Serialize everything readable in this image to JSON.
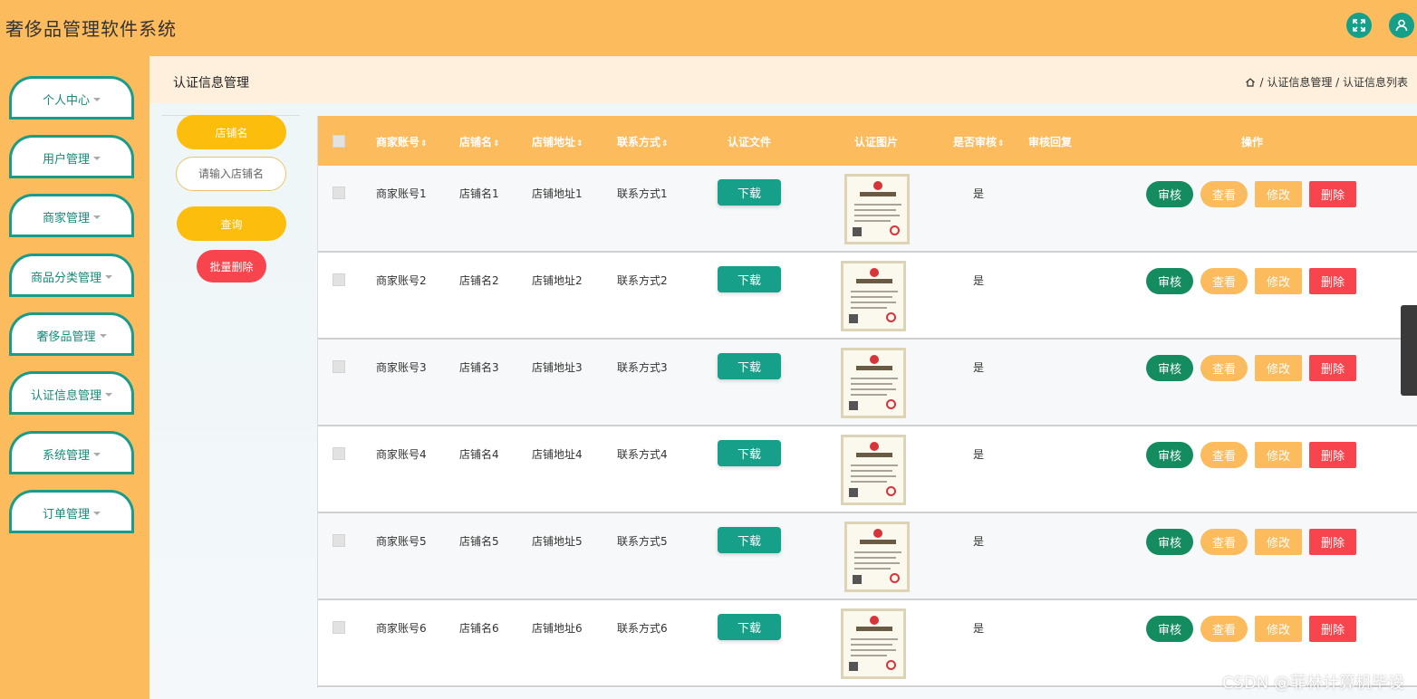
{
  "app": {
    "title": "奢侈品管理软件系统"
  },
  "topbar": {
    "fullscreen_icon": "expand-icon",
    "user_icon": "user-icon"
  },
  "sidebar": {
    "items": [
      {
        "label": "个人中心"
      },
      {
        "label": "用户管理"
      },
      {
        "label": "商家管理"
      },
      {
        "label": "商品分类管理"
      },
      {
        "label": "奢侈品管理"
      },
      {
        "label": "认证信息管理"
      },
      {
        "label": "系统管理"
      },
      {
        "label": "订单管理"
      }
    ]
  },
  "breadcrumb": {
    "title": "认证信息管理",
    "home_icon": "home-icon",
    "path": "/ 认证信息管理 / 认证信息列表"
  },
  "search": {
    "field_label": "店铺名",
    "input_placeholder": "请输入店铺名",
    "query_label": "查询",
    "batch_delete_label": "批量删除"
  },
  "table": {
    "headers": [
      "商家账号",
      "店铺名",
      "店铺地址",
      "联系方式",
      "认证文件",
      "认证图片",
      "是否审核",
      "审核回复",
      "操作"
    ],
    "sortable_marker": "⇕",
    "rows": [
      {
        "account": "商家账号1",
        "shop": "店铺名1",
        "address": "店铺地址1",
        "contact": "联系方式1",
        "file_btn": "下载",
        "audited": "是",
        "reply": ""
      },
      {
        "account": "商家账号2",
        "shop": "店铺名2",
        "address": "店铺地址2",
        "contact": "联系方式2",
        "file_btn": "下载",
        "audited": "是",
        "reply": ""
      },
      {
        "account": "商家账号3",
        "shop": "店铺名3",
        "address": "店铺地址3",
        "contact": "联系方式3",
        "file_btn": "下载",
        "audited": "是",
        "reply": ""
      },
      {
        "account": "商家账号4",
        "shop": "店铺名4",
        "address": "店铺地址4",
        "contact": "联系方式4",
        "file_btn": "下载",
        "audited": "是",
        "reply": ""
      },
      {
        "account": "商家账号5",
        "shop": "店铺名5",
        "address": "店铺地址5",
        "contact": "联系方式5",
        "file_btn": "下载",
        "audited": "是",
        "reply": ""
      },
      {
        "account": "商家账号6",
        "shop": "店铺名6",
        "address": "店铺地址6",
        "contact": "联系方式6",
        "file_btn": "下载",
        "audited": "是",
        "reply": ""
      }
    ],
    "actions": {
      "audit": "审核",
      "view": "查看",
      "edit": "修改",
      "delete": "删除"
    }
  },
  "watermark": "CSDN @菲林计算机毕设",
  "colors": {
    "brand": "#fcbb5d",
    "accent": "#16a08a",
    "danger": "#f8454d",
    "query": "#fdbd0c"
  }
}
